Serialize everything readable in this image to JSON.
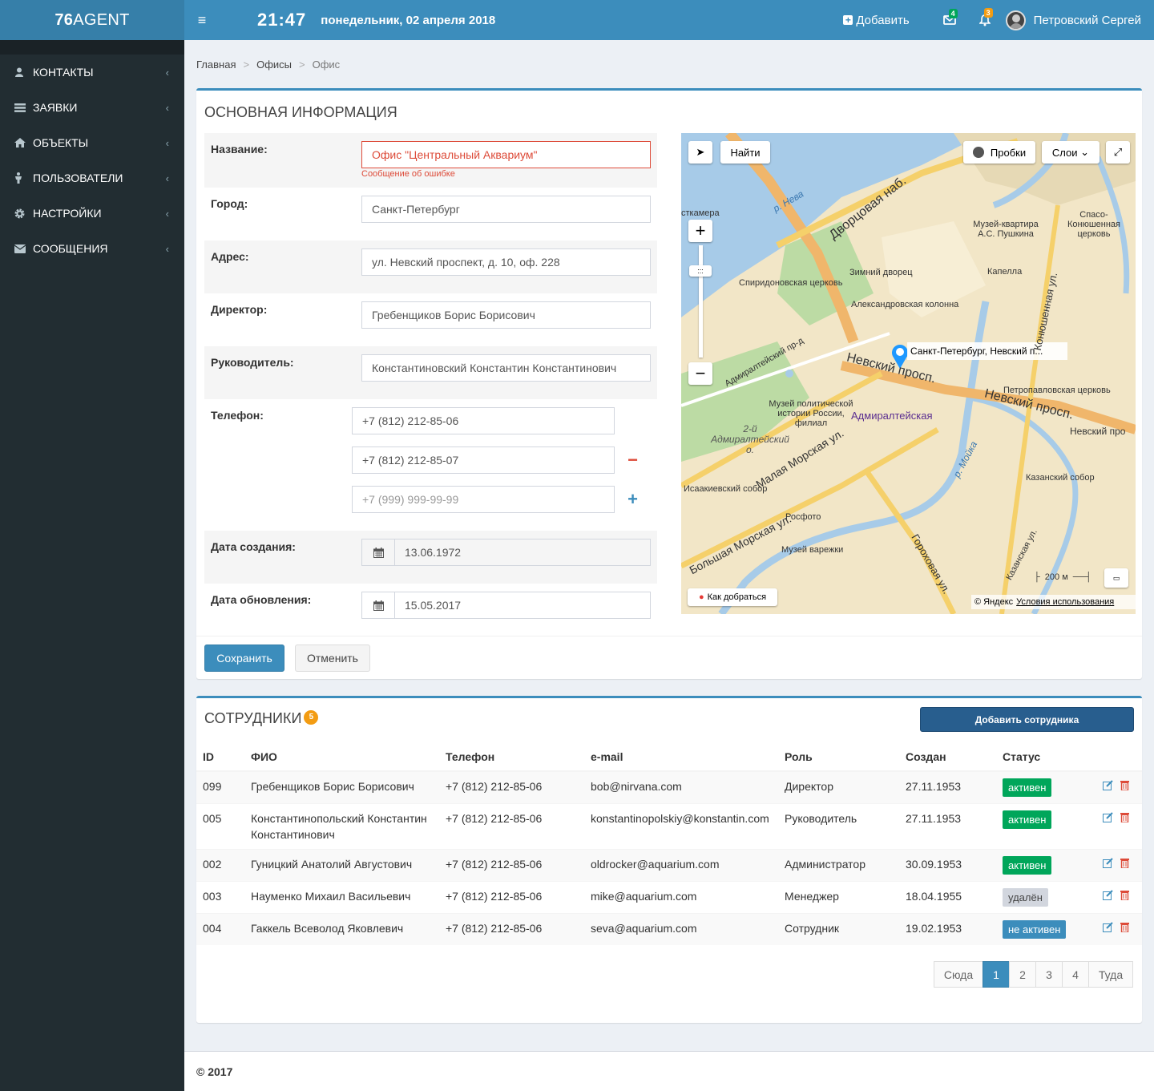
{
  "app": {
    "logo_bold": "76",
    "logo_rest": "AGENT",
    "clock": "21:47",
    "date": "понедельник, 02 апреля 2018"
  },
  "topbar": {
    "add_label": "Добавить",
    "mail_count": "4",
    "notif_count": "3",
    "user_name": "Петровский Сергей",
    "colors": {
      "bar": "#3c8dbc",
      "logo": "#367fa9",
      "mail_badge": "#00a65a",
      "notif_badge": "#f39c12"
    }
  },
  "sidebar": {
    "items": [
      {
        "label": "Контакты",
        "icon": "user-icon"
      },
      {
        "label": "Заявки",
        "icon": "list-icon"
      },
      {
        "label": "Объекты",
        "icon": "home-icon"
      },
      {
        "label": "Пользователи",
        "icon": "male-icon"
      },
      {
        "label": "Настройки",
        "icon": "gear-icon"
      },
      {
        "label": "Сообщения",
        "icon": "envelope-icon"
      }
    ]
  },
  "breadcrumb": [
    "Главная",
    "Офисы",
    "Офис"
  ],
  "info": {
    "title": "Основная информация",
    "name_label": "Название:",
    "name_value": "Офис \"Центральный Аквариум\"",
    "name_error": "Сообщение об ошибке",
    "city_label": "Город:",
    "city_value": "Санкт-Петербург",
    "address_label": "Адрес:",
    "address_value": "ул. Невский проспект, д. 10, оф. 228",
    "director_label": "Директор:",
    "director_value": "Гребенщиков Борис Борисович",
    "head_label": "Руководитель:",
    "head_value": "Константиновский Константин Константинович",
    "phone_label": "Телефон:",
    "phones": [
      "+7 (812) 212-85-06",
      "+7 (812) 212-85-07"
    ],
    "phone_placeholder": "+7 (999) 999-99-99",
    "created_label": "Дата создания:",
    "created_value": "13.06.1972",
    "updated_label": "Дата обновления:",
    "updated_value": "15.05.2017",
    "save": "Сохранить",
    "cancel": "Отменить"
  },
  "map": {
    "find": "Найти",
    "traffic": "Пробки",
    "layers": "Слои",
    "marker_label": "Санкт-Петербург, Невский п...",
    "route": "Как добраться",
    "scale": "200 м",
    "copyright": "© Яндекс",
    "terms": "Условия использования",
    "labels": {
      "neva": "р. Нева",
      "embankment": "Дворцовая наб.",
      "nevsky1": "Невский просп.",
      "nevsky2": "Невский просп.",
      "admiralteyskaya": "Адмиралтейская",
      "winter_palace": "Зимний дворец",
      "column": "Александровская колонна",
      "pushkin": "Музей-квартира А.С. Пушкина",
      "church_spiridon": "Спиридоновская церковь",
      "church_spas": "Спасо-Конюшенная церковь",
      "kapella": "Капелла",
      "moika": "р. Мойка",
      "malaya_morskaya": "Малая Морская ул.",
      "bolshaya_morskaya": "Большая Морская ул.",
      "isaac": "Исаакиевский собор",
      "kazan": "Казанский собор",
      "rosfoto": "Росфото",
      "museum_politics": "Музей политической истории России, филиал",
      "museum_vareniki": "Музей варежки",
      "peter_paul": "Петропавловская церковь",
      "admir_o": "2-й Адмиралтейский о.",
      "admir_pr": "Адмиралтейский пр-д",
      "gorokhovaya": "Гороховая ул.",
      "konyushennaya": "Конюшенная ул.",
      "kunstkamera": "сткамера",
      "nevsky_metro": "Невский про",
      "kazanskaya": "Казанская ул."
    }
  },
  "employees": {
    "title": "Сотрудники",
    "count": "5",
    "add_button": "Добавить сотрудника",
    "columns": [
      "ID",
      "ФИО",
      "Телефон",
      "e-mail",
      "Роль",
      "Создан",
      "Статус"
    ],
    "rows": [
      {
        "id": "099",
        "name": "Гребенщиков Борис Борисович",
        "phone": "+7 (812) 212-85-06",
        "email": "bob@nirvana.com",
        "role": "Директор",
        "created": "27.11.1953",
        "status": "активен",
        "status_type": "green"
      },
      {
        "id": "005",
        "name": "Константинопольский Константин Константинович",
        "phone": "+7 (812) 212-85-06",
        "email": "konstantinopolskiy@konstantin.com",
        "role": "Руководитель",
        "created": "27.11.1953",
        "status": "активен",
        "status_type": "green"
      },
      {
        "id": "002",
        "name": "Гуницкий Анатолий Августович",
        "phone": "+7 (812) 212-85-06",
        "email": "oldrocker@aquarium.com",
        "role": "Администратор",
        "created": "30.09.1953",
        "status": "активен",
        "status_type": "green"
      },
      {
        "id": "003",
        "name": "Науменко Михаил Васильевич",
        "phone": "+7 (812) 212-85-06",
        "email": "mike@aquarium.com",
        "role": "Менеджер",
        "created": "18.04.1955",
        "status": "удалён",
        "status_type": "gray"
      },
      {
        "id": "004",
        "name": "Гаккель Всеволод Яковлевич",
        "phone": "+7 (812) 212-85-06",
        "email": "seva@aquarium.com",
        "role": "Сотрудник",
        "created": "19.02.1953",
        "status": "не активен",
        "status_type": "blue"
      }
    ],
    "pagination": {
      "prev": "Сюда",
      "pages": [
        "1",
        "2",
        "3",
        "4"
      ],
      "active": "1",
      "next": "Туда"
    }
  },
  "footer": "© 2017"
}
